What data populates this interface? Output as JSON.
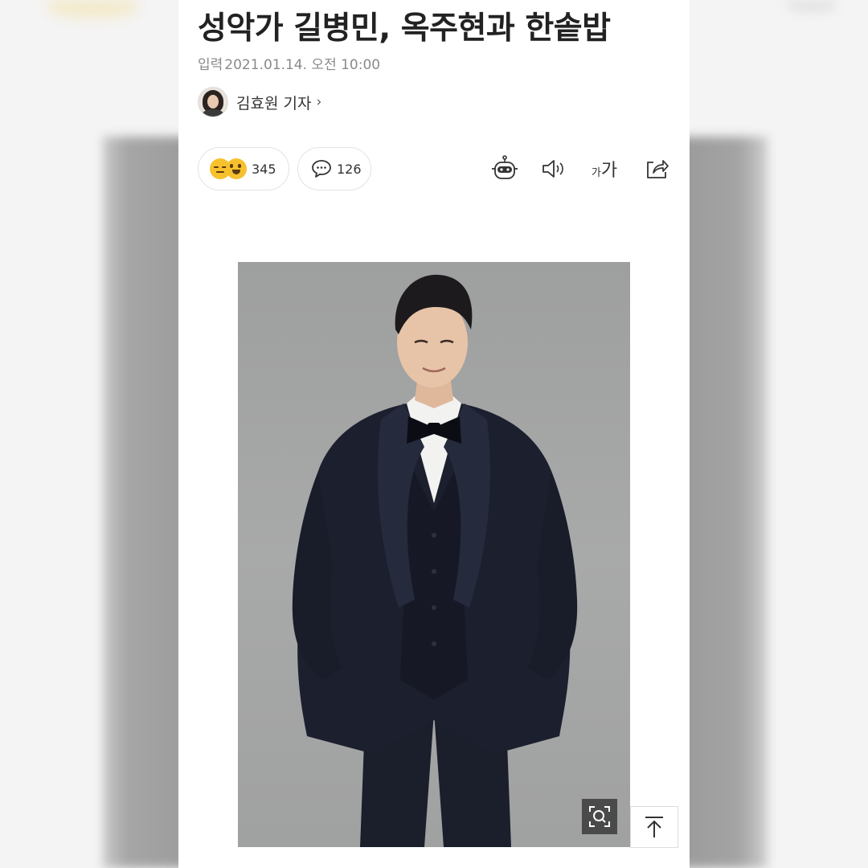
{
  "article": {
    "title": "성악가 길병민, 옥주현과 한솥밥",
    "published_label": "입력",
    "published_at": "2021.01.14. 오전 10:00",
    "reporter": {
      "name": "김효원 기자",
      "chevron": "›"
    }
  },
  "actions": {
    "reaction_count": "345",
    "comment_count": "126",
    "font_size_small": "가",
    "font_size_large": "가"
  },
  "icons": {
    "reaction": [
      "sleepy-emoji-icon",
      "happy-emoji-icon"
    ],
    "comment": "speech-bubble-icon",
    "robot": "robot-summary-icon",
    "sound": "speaker-icon",
    "share": "share-icon",
    "zoom": "zoom-icon",
    "top": "arrow-up-icon"
  },
  "colors": {
    "emoji": "#f7c12e",
    "title": "#222222",
    "meta": "#8a8a8a",
    "photo_background": "#a3a4a4",
    "tuxedo": "#1c1f2e"
  }
}
